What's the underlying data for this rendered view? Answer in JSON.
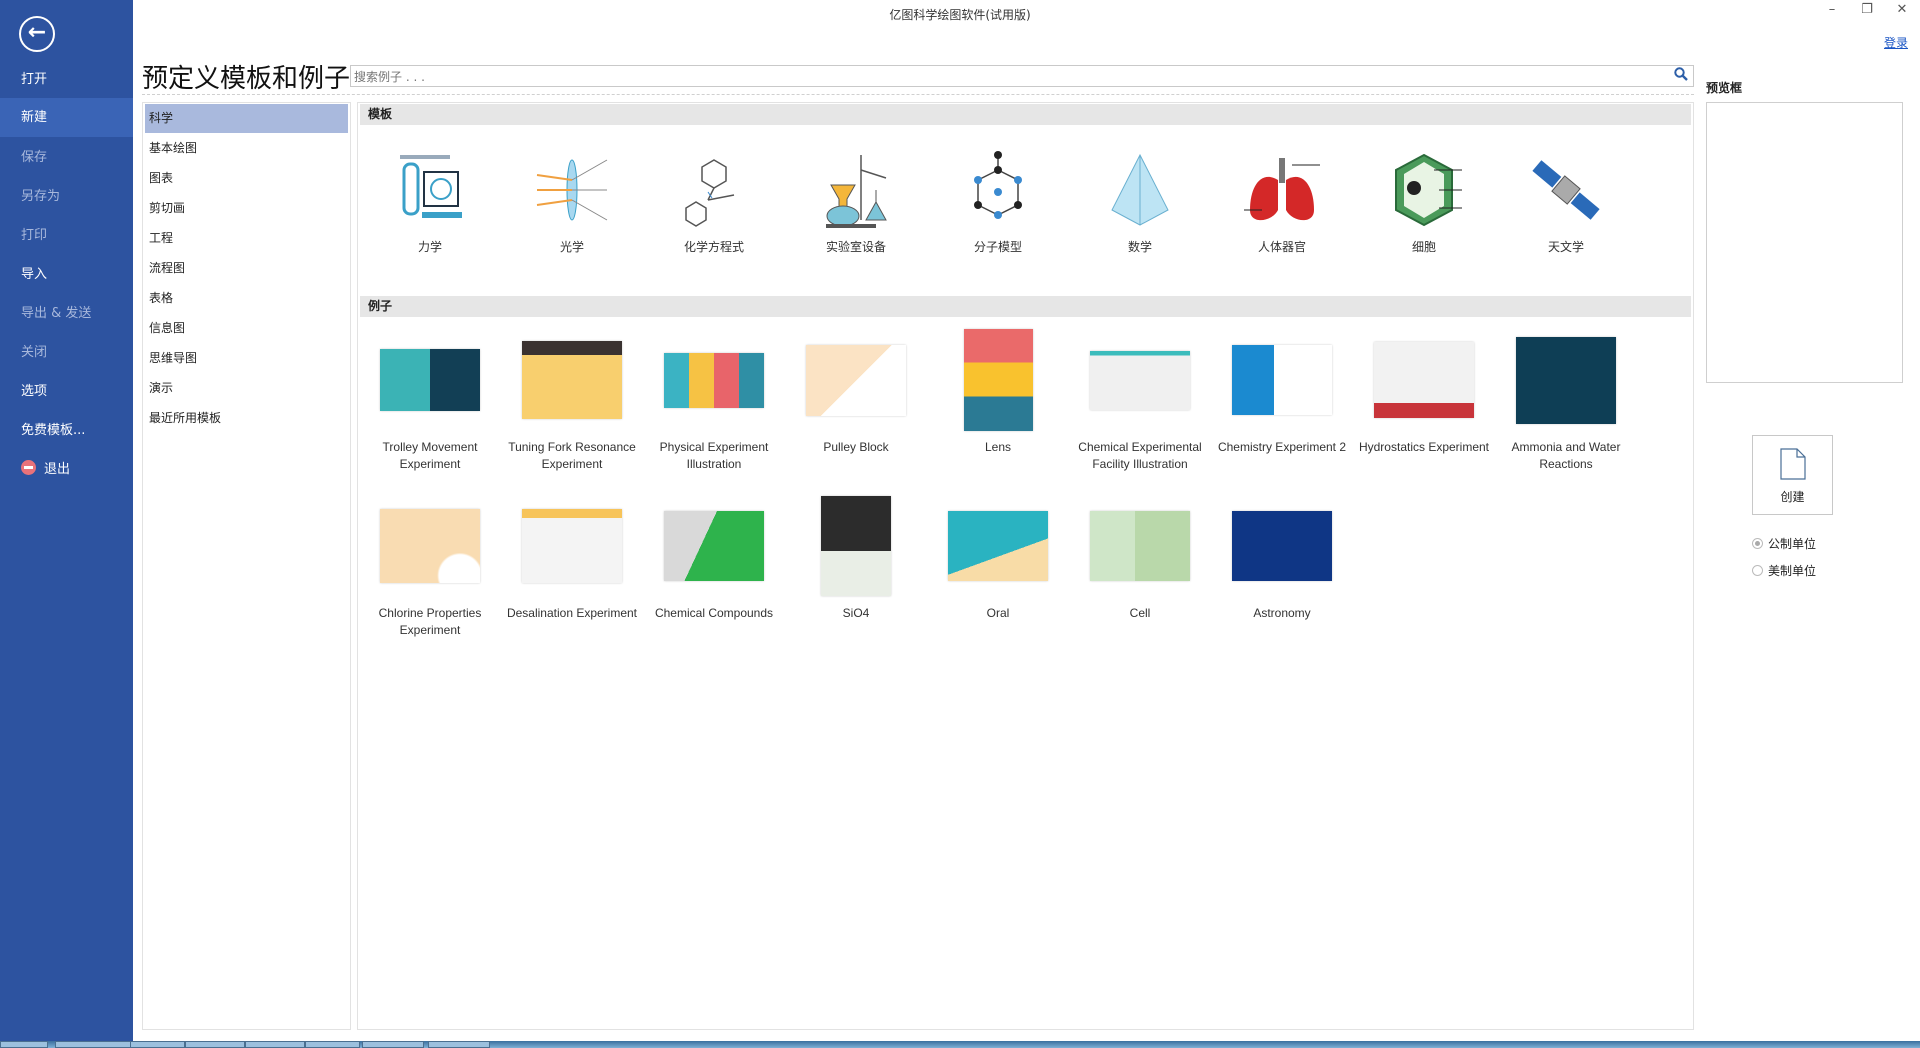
{
  "window": {
    "title": "亿图科学绘图软件(试用版)",
    "minimize": "–",
    "restore": "❐",
    "close": "✕",
    "login": "登录"
  },
  "sidebar": {
    "back_icon": "←",
    "items": [
      {
        "label": "打开",
        "dim": false
      },
      {
        "label": "新建",
        "dim": false,
        "selected": true
      },
      {
        "label": "保存",
        "dim": true
      },
      {
        "label": "另存为",
        "dim": true
      },
      {
        "label": "打印",
        "dim": true
      },
      {
        "label": "导入",
        "dim": false
      },
      {
        "label": "导出 & 发送",
        "dim": true
      },
      {
        "label": "关闭",
        "dim": true
      },
      {
        "label": "选项",
        "dim": false
      },
      {
        "label": "免费模板...",
        "dim": false
      },
      {
        "label": "退出",
        "dim": false,
        "icon": "exit-icon"
      }
    ]
  },
  "header": {
    "title": "预定义模板和例子",
    "search_placeholder": "搜索例子 . . ."
  },
  "categories": [
    {
      "label": "科学",
      "selected": true
    },
    {
      "label": "基本绘图"
    },
    {
      "label": "图表"
    },
    {
      "label": "剪切画"
    },
    {
      "label": "工程"
    },
    {
      "label": "流程图"
    },
    {
      "label": "表格"
    },
    {
      "label": "信息图"
    },
    {
      "label": "思维导图"
    },
    {
      "label": "演示"
    },
    {
      "label": "最近所用模板"
    }
  ],
  "templates": {
    "heading": "模板",
    "items": [
      {
        "label": "力学",
        "icon": "mechanics-icon"
      },
      {
        "label": "光学",
        "icon": "optics-icon"
      },
      {
        "label": "化学方程式",
        "icon": "chemical-formula-icon"
      },
      {
        "label": "实验室设备",
        "icon": "lab-equipment-icon"
      },
      {
        "label": "分子模型",
        "icon": "molecule-icon"
      },
      {
        "label": "数学",
        "icon": "pyramid-icon"
      },
      {
        "label": "人体器官",
        "icon": "lungs-icon"
      },
      {
        "label": "细胞",
        "icon": "cell-icon"
      },
      {
        "label": "天文学",
        "icon": "satellite-icon"
      }
    ]
  },
  "examples": {
    "heading": "例子",
    "items": [
      {
        "label": "Trolley Movement Experiment"
      },
      {
        "label": "Tuning Fork Resonance Experiment"
      },
      {
        "label": "Physical Experiment Illustration"
      },
      {
        "label": "Pulley Block"
      },
      {
        "label": "Lens"
      },
      {
        "label": "Chemical Experimental Facility Illustration"
      },
      {
        "label": "Chemistry Experiment 2"
      },
      {
        "label": "Hydrostatics Experiment"
      },
      {
        "label": "Ammonia and Water Reactions"
      },
      {
        "label": "Chlorine Properties Experiment"
      },
      {
        "label": "Desalination Experiment"
      },
      {
        "label": "Chemical Compounds"
      },
      {
        "label": "SiO4"
      },
      {
        "label": "Oral"
      },
      {
        "label": "Cell"
      },
      {
        "label": "Astronomy"
      }
    ]
  },
  "preview": {
    "label": "预览框",
    "create_label": "创建",
    "units": [
      {
        "label": "公制单位",
        "checked": true
      },
      {
        "label": "美制单位",
        "checked": false
      }
    ]
  }
}
